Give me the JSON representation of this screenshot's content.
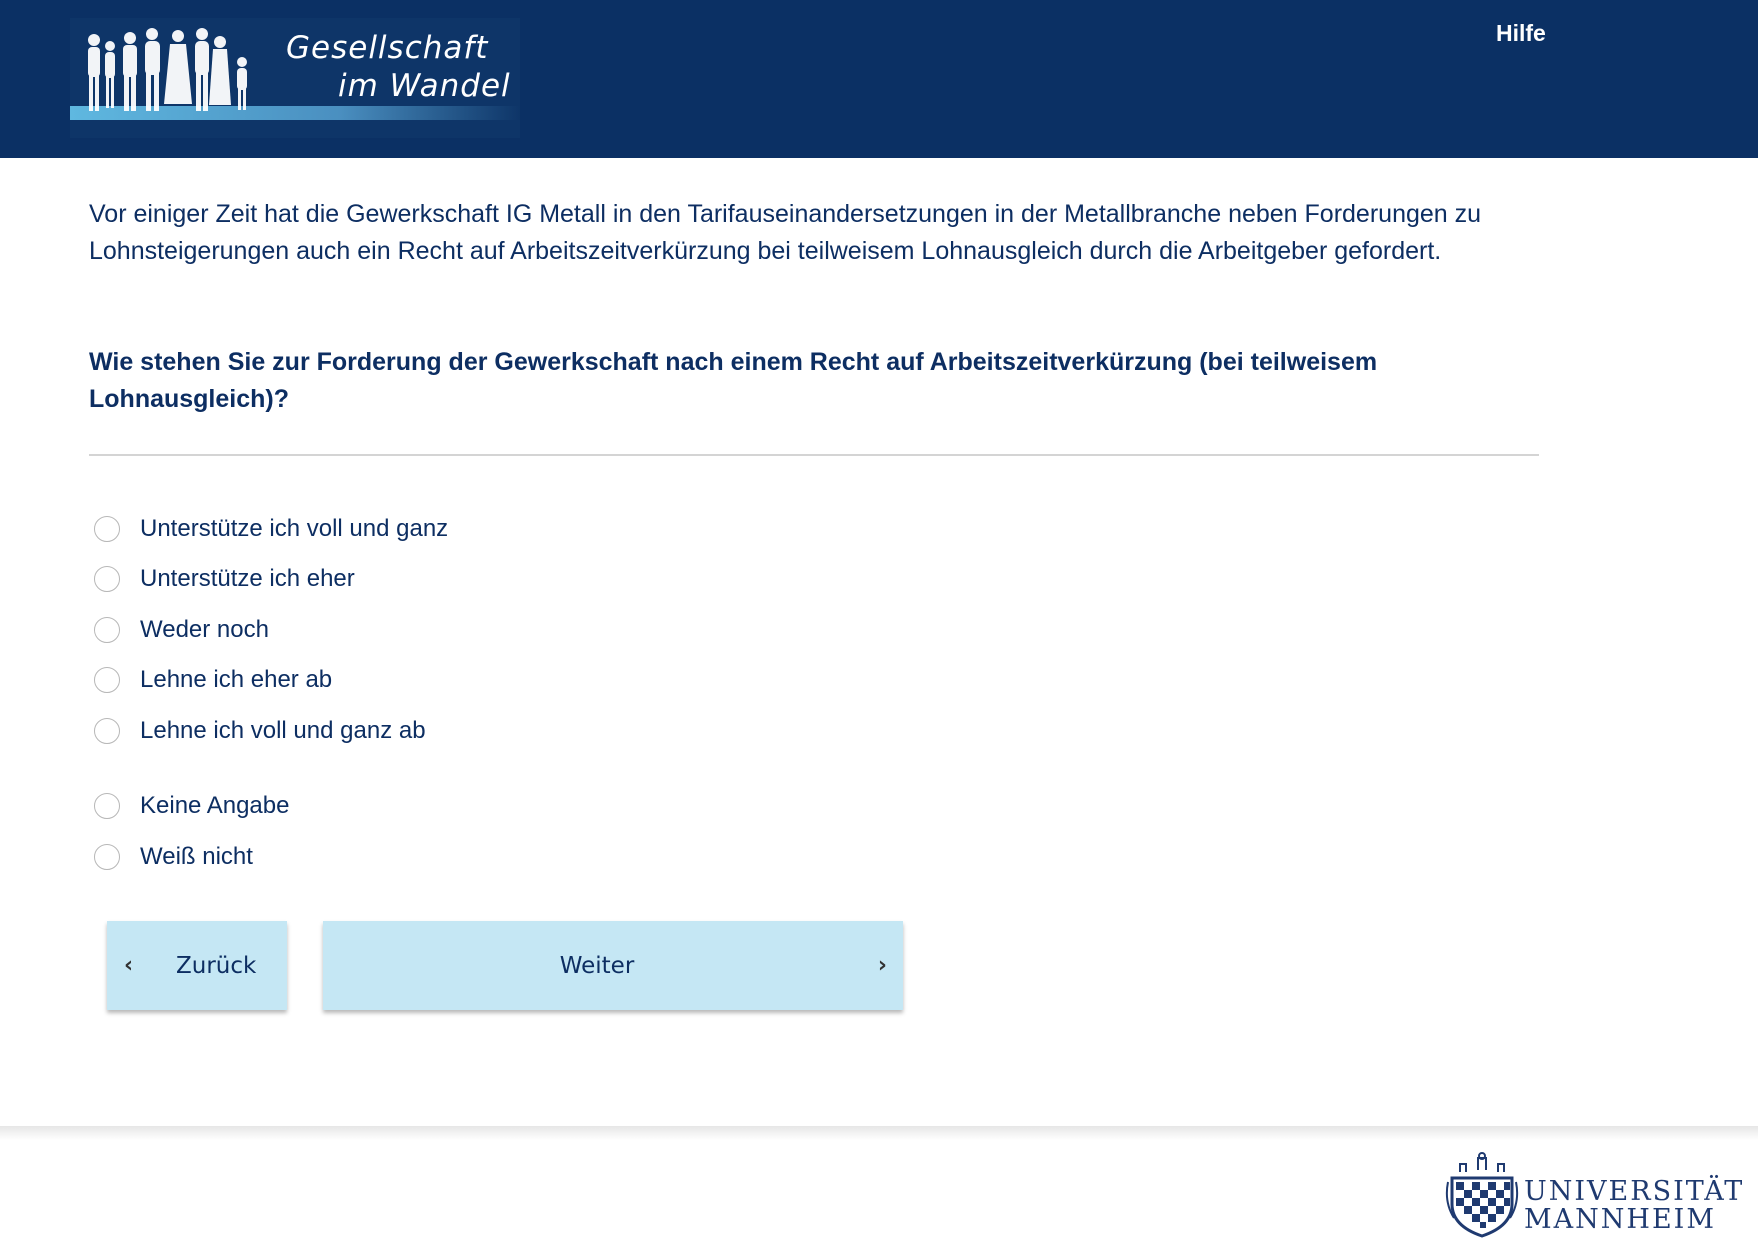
{
  "header": {
    "logo_line1": "Gesellschaft",
    "logo_line2": "im Wandel",
    "help_label": "Hilfe"
  },
  "survey": {
    "intro": "Vor einiger Zeit hat die Gewerkschaft IG Metall in den Tarifauseinandersetzungen in der Metallbranche neben Forderungen zu Lohnsteigerungen auch ein Recht auf Arbeitszeitverkürzung bei teilweisem Lohnausgleich durch die Arbeitgeber gefordert.",
    "question": "Wie stehen Sie zur Forderung der Gewerkschaft nach einem Recht auf Arbeitszeitverkürzung (bei teilweisem Lohnausgleich)?",
    "options": [
      {
        "label": "Unterstütze ich voll und ganz"
      },
      {
        "label": "Unterstütze ich eher"
      },
      {
        "label": "Weder noch"
      },
      {
        "label": "Lehne ich eher ab"
      },
      {
        "label": "Lehne ich voll und ganz ab"
      },
      {
        "label": "Keine Angabe"
      },
      {
        "label": "Weiß nicht"
      }
    ],
    "selected": null
  },
  "nav": {
    "back_label": "Zurück",
    "next_label": "Weiter"
  },
  "footer": {
    "university_line1": "UNIVERSITÄT",
    "university_line2": "MANNHEIM"
  },
  "colors": {
    "header_bg": "#0b3064",
    "text": "#0d2e62",
    "button_bg": "#c5e7f4"
  }
}
